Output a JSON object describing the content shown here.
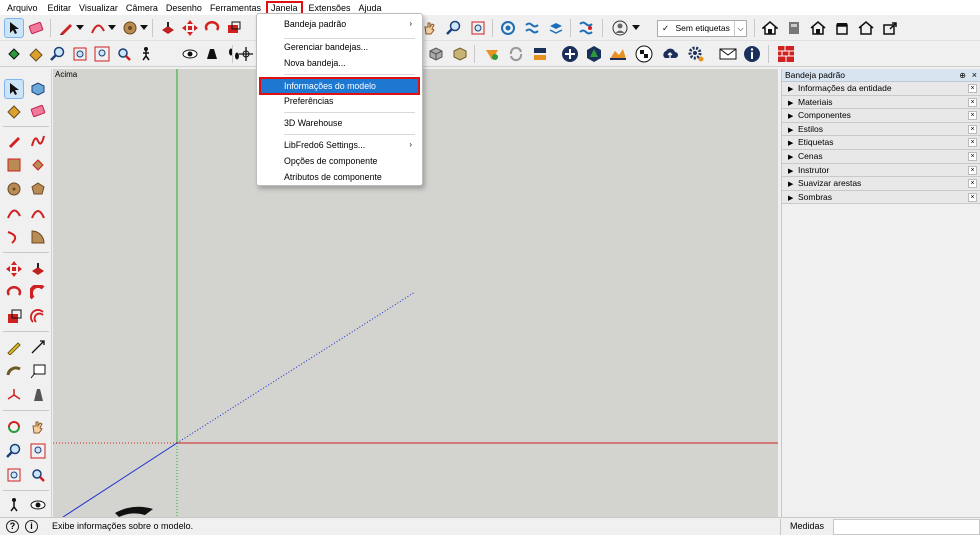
{
  "menubar": {
    "items": [
      "Arquivo",
      "Editar",
      "Visualizar",
      "Câmera",
      "Desenho",
      "Ferramentas",
      "Janela",
      "Extensões",
      "Ajuda"
    ],
    "active_index": 6
  },
  "toolbar": {
    "tag_select": {
      "checkmark": "✓",
      "value": "Sem etiquetas",
      "chevron": "⌵"
    },
    "icons": [
      "select-icon",
      "eraser-icon",
      "pencil-icon",
      "arc-icon",
      "shape-icon",
      "push-pull-icon",
      "move-icon",
      "rotate-icon",
      "orbit-icon",
      "pan-icon",
      "zoom-icon",
      "zoom-extents-icon",
      "warehouse-icon",
      "extension-icon",
      "layer-icon",
      "section-icon",
      "user-icon",
      "house-icon",
      "component-icon",
      "home-icon",
      "shop-icon",
      "home-outline-icon",
      "export-icon"
    ]
  },
  "window_menu": {
    "items": [
      {
        "label": "Bandeja padrão",
        "submenu": "›"
      },
      {
        "label": "Gerenciar bandejas..."
      },
      {
        "label": "Nova bandeja..."
      },
      {
        "label": "Informações do modelo",
        "highlighted": true
      },
      {
        "label": "Preferências"
      },
      {
        "label": "3D Warehouse"
      },
      {
        "label": "LibFredo6 Settings...",
        "submenu": "›"
      },
      {
        "label": "Opções de componente"
      },
      {
        "label": "Atributos de componente"
      }
    ]
  },
  "viewport": {
    "scene_label": "Acima",
    "background": "#d3d3cf",
    "axis_colors": {
      "red": "#d02020",
      "green": "#20b020",
      "blue": "#1a2fd0"
    }
  },
  "tray": {
    "title": "Bandeja padrão",
    "pin": "⊕",
    "close": "×",
    "panels": [
      "Informações da entidade",
      "Materiais",
      "Componentes",
      "Estilos",
      "Etiquetas",
      "Cenas",
      "Instrutor",
      "Suavizar arestas",
      "Sombras"
    ],
    "panel_arrow": "▶",
    "panel_close": "×"
  },
  "statusbar": {
    "icon1": "?",
    "icon2": "i",
    "text": "Exibe informações sobre o modelo.",
    "measure_label": "Medidas",
    "measure_value": ""
  },
  "colors": {
    "accent_highlight": "#1e78d2",
    "annotation_red": "#e01010"
  }
}
